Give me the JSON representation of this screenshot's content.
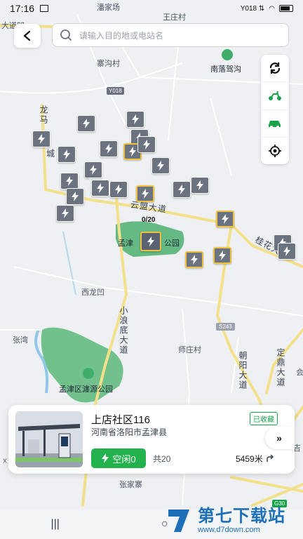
{
  "status_bar": {
    "time": "17:16",
    "signal": "Y018 ⇅",
    "battery_icon": "battery-icon"
  },
  "search": {
    "placeholder": "请输入目的地或电站名"
  },
  "map": {
    "labels": {
      "pan_jia_chang": "潘家场",
      "wang_zhuang_cun": "王庄村",
      "da_dao_ao": "大道凹",
      "zhai_gou_cun": "寨沟村",
      "nan_luo_jia_gou": "南落驾沟",
      "long_ma": "龙马",
      "cheng": "城",
      "yun_meng_da_dao": "云盟大道",
      "meng_jin_park_a": "孟津",
      "meng_jin_park_b": "公园",
      "gui_hua_da_dao": "桂花大道",
      "xi_long_ao": "西龙凹",
      "xiao_lang_di_da_dao": "小浪底大道",
      "zhang_wan": "张湾",
      "shi_zhuang_cun": "师庄村",
      "chao_yang_da_dao": "朝阳大道",
      "meng_jin_pan_yuan": "孟津区瀍源公园",
      "zhang_jia_zhai": "张家寨",
      "ding_ding_da_dao": "定鼎大道",
      "hui": "会",
      "ji": "吉",
      "xi": "X"
    },
    "road_badges": {
      "y018": "Y018",
      "s243": "S243",
      "g30": "G30"
    },
    "selected_count": "0/20"
  },
  "tools": [
    "refresh-icon",
    "scooter-icon",
    "car-icon",
    "locate-icon"
  ],
  "station_card": {
    "name": "上店社区116",
    "address": "河南省洛阳市孟津县",
    "favorite_label": "已收藏",
    "free_label": "空闲0",
    "total_label": "共20",
    "distance": "5459米"
  },
  "expand_label": "»",
  "watermark": {
    "title": "第七下载站",
    "url": "www.d7down.com"
  },
  "colors": {
    "accent": "#22b14c",
    "marker": "#6b7280",
    "marker_border": "#f0c040",
    "road": "#f3e08a",
    "park": "#3fae6a"
  }
}
